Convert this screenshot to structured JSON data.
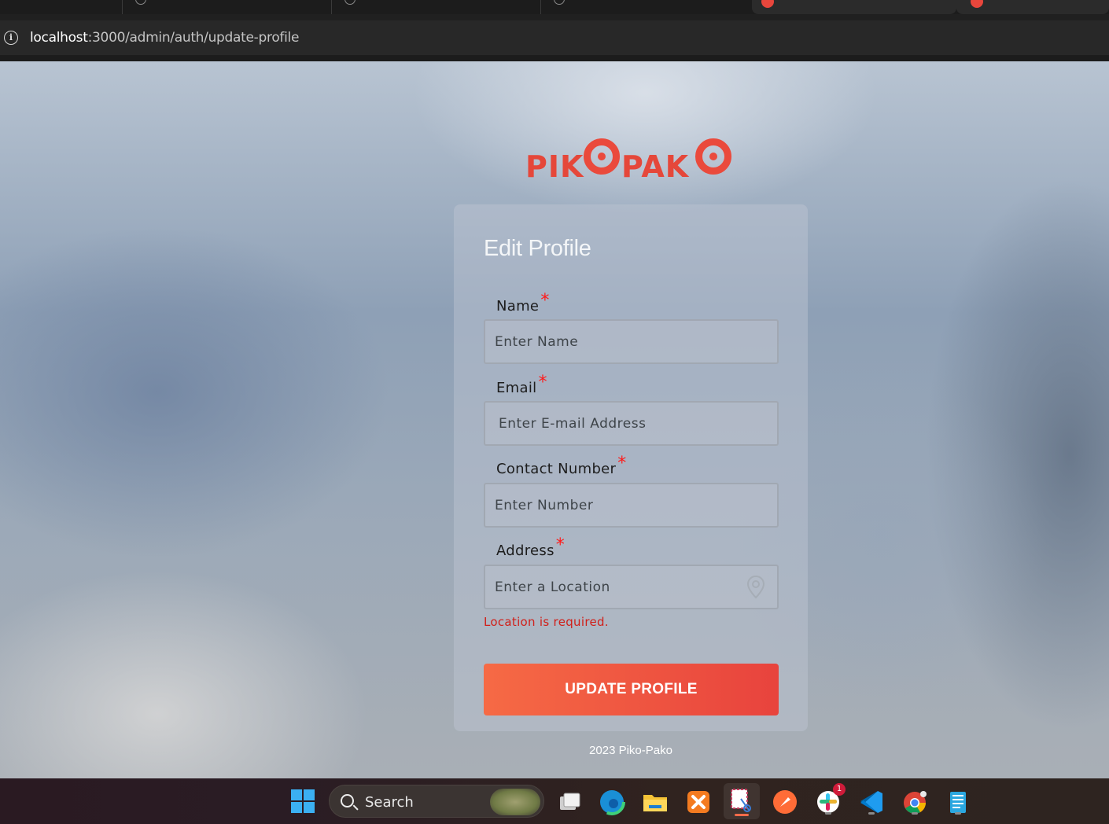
{
  "browser": {
    "url_host": "localhost",
    "url_path": ":3000/admin/auth/update-profile"
  },
  "logo": {
    "part1": "PIK",
    "part2": "PAK",
    "brand_color": "#e5473a"
  },
  "form": {
    "title": "Edit Profile",
    "fields": {
      "name": {
        "label": "Name",
        "required_mark": "*",
        "placeholder": "Enter Name"
      },
      "email": {
        "label": "Email",
        "required_mark": "*",
        "placeholder": "Enter E-mail Address"
      },
      "contact": {
        "label": "Contact Number",
        "required_mark": "*",
        "placeholder": "Enter Number"
      },
      "address": {
        "label": "Address",
        "required_mark": "*",
        "placeholder": "Enter a Location",
        "icon": "map-pin-icon"
      }
    },
    "error": "Location is required.",
    "submit_label": "UPDATE PROFILE",
    "submit_colors": [
      "#f66a45",
      "#e8433d"
    ]
  },
  "footer": {
    "text": "2023 Piko-Pako"
  },
  "taskbar": {
    "search_label": "Search",
    "apps": [
      "windows-start-icon",
      "task-view-icon",
      "edge-icon",
      "file-explorer-icon",
      "xampp-icon",
      "snipping-tool-icon",
      "postman-icon",
      "slack-icon",
      "vscode-icon",
      "chrome-icon",
      "notepad-icon"
    ],
    "slack_badge": "1"
  }
}
